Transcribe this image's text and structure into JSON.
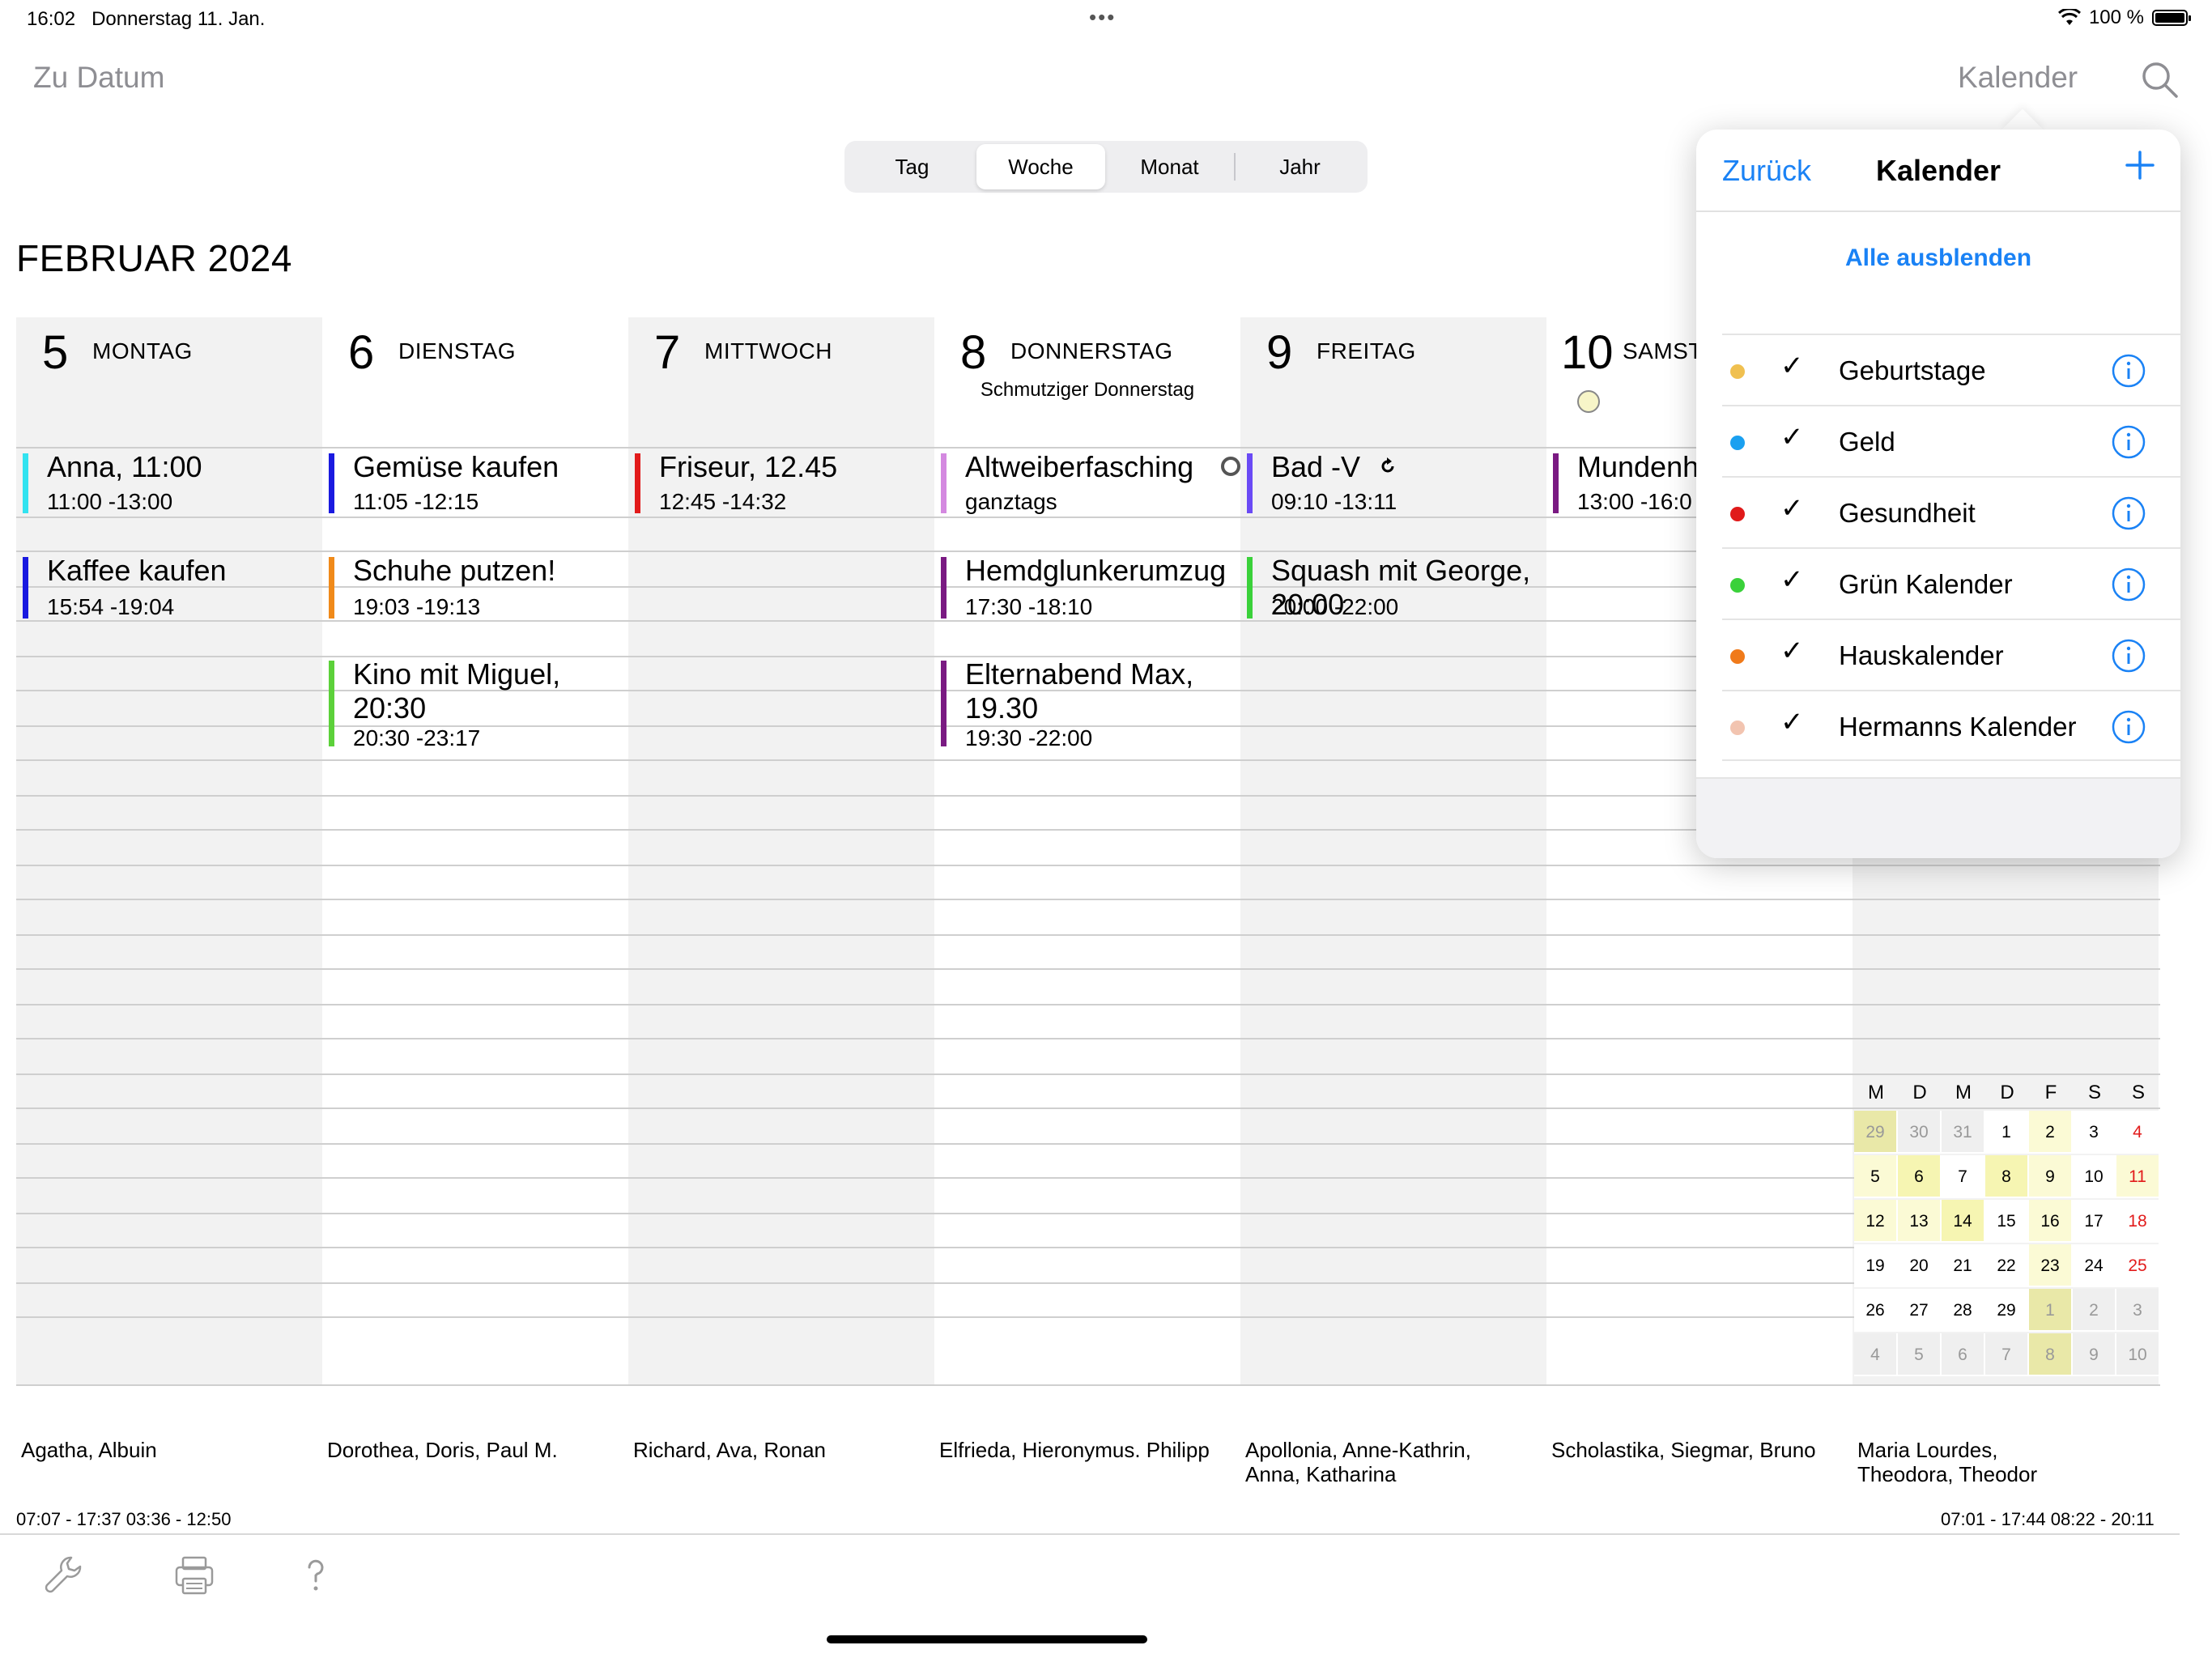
{
  "status": {
    "time": "16:02",
    "date": "Donnerstag 11. Jan.",
    "dots": "•••",
    "battery": "100 %"
  },
  "nav": {
    "left": "Zu Datum",
    "right": "Kalender"
  },
  "segments": [
    "Tag",
    "Woche",
    "Monat",
    "Jahr"
  ],
  "active_segment": "Woche",
  "month_title": "FEBRUAR 2024",
  "days": [
    {
      "num": "5",
      "name": "MONTAG",
      "sub": ""
    },
    {
      "num": "6",
      "name": "DIENSTAG",
      "sub": ""
    },
    {
      "num": "7",
      "name": "MITTWOCH",
      "sub": ""
    },
    {
      "num": "8",
      "name": "DONNERSTAG",
      "sub": "Schmutziger Donnerstag"
    },
    {
      "num": "9",
      "name": "FREITAG",
      "sub": ""
    },
    {
      "num": "10",
      "name": "SAMSTAG",
      "sub": ""
    }
  ],
  "events": {
    "mon_1": {
      "title": "Anna, 11:00",
      "time": "11:00 -13:00",
      "color": "#33e3f0"
    },
    "mon_2": {
      "title": "Kaffee kaufen",
      "time": "15:54 -19:04",
      "color": "#1a1ae0"
    },
    "tue_1": {
      "title": "Gemüse kaufen",
      "time": "11:05 -12:15",
      "color": "#1a1ae0"
    },
    "tue_2": {
      "title": "Schuhe putzen!",
      "time": "19:03 -19:13",
      "color": "#f08a1a"
    },
    "tue_3": {
      "title": "Kino mit Miguel, 20:30",
      "time": "20:30 -23:17",
      "color": "#5cd13a"
    },
    "wed_1": {
      "title": "Friseur, 12.45",
      "time": "12:45 -14:32",
      "color": "#e21b1b"
    },
    "thu_1": {
      "title": "Altweiberfasching",
      "time": "ganztags",
      "color": "#d489e0"
    },
    "thu_2": {
      "title": "Hemdglunkerumzug",
      "time": "17:30 -18:10",
      "color": "#7a1a82"
    },
    "thu_3": {
      "title": "Elternabend Max, 19.30",
      "time": "19:30 -22:00",
      "color": "#7a1a82"
    },
    "fri_1": {
      "title": "Bad -V",
      "time": "09:10 -13:11",
      "color": "#6a4af5"
    },
    "fri_2": {
      "title": "Squash mit George, 20:00",
      "time": "20:00 -22:00",
      "color": "#3ad13a"
    },
    "sat_1": {
      "title": "Mundenh",
      "time": "13:00 -16:0",
      "color": "#7a1a82"
    }
  },
  "saints": [
    "Agatha, Albuin",
    "Dorothea, Doris, Paul M.",
    "Richard, Ava, Ronan",
    "Elfrieda, Hieronymus. Philipp",
    "Apollonia, Anne-Kathrin, Anna, Katharina",
    "Scholastika, Siegmar, Bruno",
    "Maria Lourdes, Theodora, Theodor"
  ],
  "sun_left": "07:07 - 17:37  03:36 - 12:50",
  "sun_right": "07:01 - 17:44  08:22 - 20:11",
  "minical": {
    "headers": [
      "M",
      "D",
      "M",
      "D",
      "F",
      "S",
      "S"
    ],
    "rows": [
      [
        "29",
        "30",
        "31",
        "1",
        "2",
        "3",
        "4"
      ],
      [
        "5",
        "6",
        "7",
        "8",
        "9",
        "10",
        "11"
      ],
      [
        "12",
        "13",
        "14",
        "15",
        "16",
        "17",
        "18"
      ],
      [
        "19",
        "20",
        "21",
        "22",
        "23",
        "24",
        "25"
      ],
      [
        "26",
        "27",
        "28",
        "29",
        "1",
        "2",
        "3"
      ],
      [
        "4",
        "5",
        "6",
        "7",
        "8",
        "9",
        "10"
      ]
    ]
  },
  "popover": {
    "back": "Zurück",
    "title": "Kalender",
    "hide_all": "Alle ausblenden",
    "calendars": [
      {
        "name": "Geburtstage",
        "color": "#f0c050"
      },
      {
        "name": "Geld",
        "color": "#1aa0f0"
      },
      {
        "name": "Gesundheit",
        "color": "#e01a1a"
      },
      {
        "name": "Grün Kalender",
        "color": "#3ad13a"
      },
      {
        "name": "Hauskalender",
        "color": "#f07a1a"
      },
      {
        "name": "Hermanns Kalender",
        "color": "#f2c4b0"
      }
    ],
    "check": "✓"
  }
}
